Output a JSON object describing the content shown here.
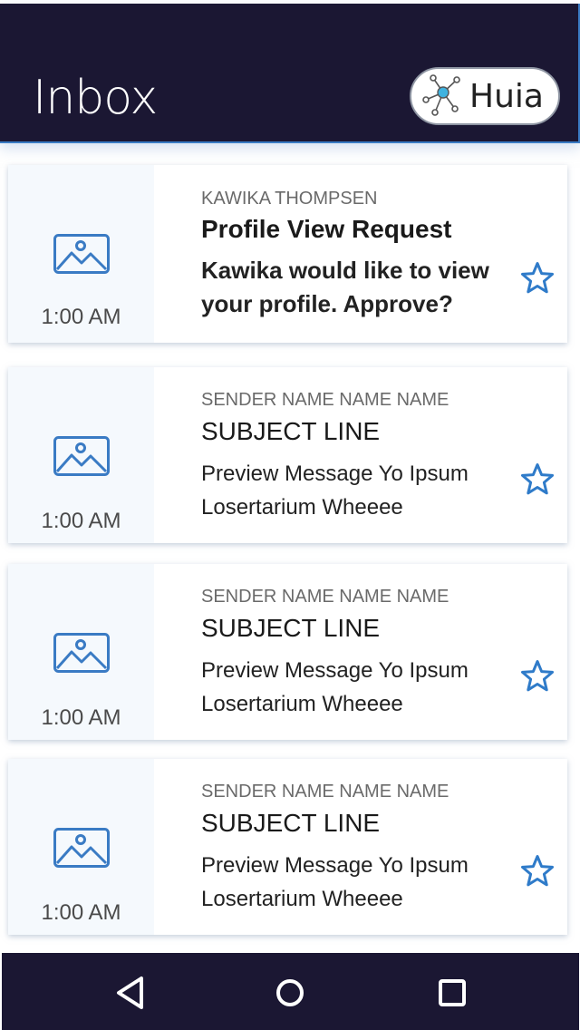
{
  "header": {
    "title": "Inbox",
    "brand_label": "Huia"
  },
  "messages": [
    {
      "sender": "KAWIKA THOMPSEN",
      "subject": "Profile View Request",
      "preview": "Kawika would like to view your profile. Approve?",
      "time": "1:00 AM",
      "starred": false,
      "unread": true
    },
    {
      "sender": "SENDER NAME NAME NAME",
      "subject": "SUBJECT LINE",
      "preview": "Preview Message Yo Ipsum Losertarium Wheeee",
      "time": "1:00 AM",
      "starred": false,
      "unread": false
    },
    {
      "sender": "SENDER NAME NAME NAME",
      "subject": "SUBJECT LINE",
      "preview": "Preview Message Yo Ipsum Losertarium Wheeee",
      "time": "1:00 AM",
      "starred": false,
      "unread": false
    },
    {
      "sender": "SENDER NAME NAME NAME",
      "subject": "SUBJECT LINE",
      "preview": "Preview Message Yo Ipsum Losertarium Wheeee",
      "time": "1:00 AM",
      "starred": false,
      "unread": false
    }
  ],
  "icons": {
    "brand": "network-node-icon",
    "thumbnail": "image-placeholder-icon",
    "star": "star-outline-icon",
    "nav_back": "back-triangle-icon",
    "nav_home": "home-circle-icon",
    "nav_recents": "recents-square-icon"
  },
  "colors": {
    "header_bg": "#1b1733",
    "accent": "#3a7bc4",
    "thumb_bg": "#f5f9fd",
    "nav_bg": "#1b1733"
  }
}
